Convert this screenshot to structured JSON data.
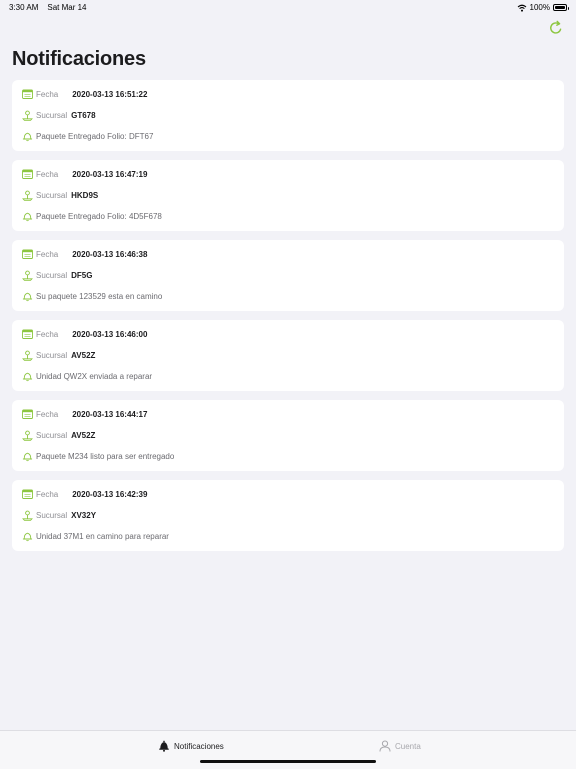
{
  "status_bar": {
    "time": "3:30 AM",
    "date": "Sat Mar 14",
    "battery": "100%"
  },
  "header": {
    "title": "Notificaciones"
  },
  "labels": {
    "fecha": "Fecha",
    "sucursal": "Sucursal"
  },
  "notifications": [
    {
      "fecha": "2020-03-13 16:51:22",
      "sucursal": "GT678",
      "message": "Paquete Entregado Folio: DFT67"
    },
    {
      "fecha": "2020-03-13 16:47:19",
      "sucursal": "HKD9S",
      "message": "Paquete Entregado Folio: 4D5F678"
    },
    {
      "fecha": "2020-03-13 16:46:38",
      "sucursal": "DF5G",
      "message": "Su paquete 123529 esta en camino"
    },
    {
      "fecha": "2020-03-13 16:46:00",
      "sucursal": "AV52Z",
      "message": "Unidad QW2X enviada a reparar"
    },
    {
      "fecha": "2020-03-13 16:44:17",
      "sucursal": "AV52Z",
      "message": "Paquete M234 listo para ser entregado"
    },
    {
      "fecha": "2020-03-13 16:42:39",
      "sucursal": "XV32Y",
      "message": "Unidad 37M1 en camino para reparar"
    }
  ],
  "tab_bar": {
    "items": [
      {
        "label": "Notificaciones",
        "icon": "bell-icon",
        "active": true
      },
      {
        "label": "Cuenta",
        "icon": "person-icon",
        "active": false
      }
    ]
  },
  "colors": {
    "accent": "#8cc63f",
    "background": "#f2f2f7",
    "card": "#ffffff"
  }
}
